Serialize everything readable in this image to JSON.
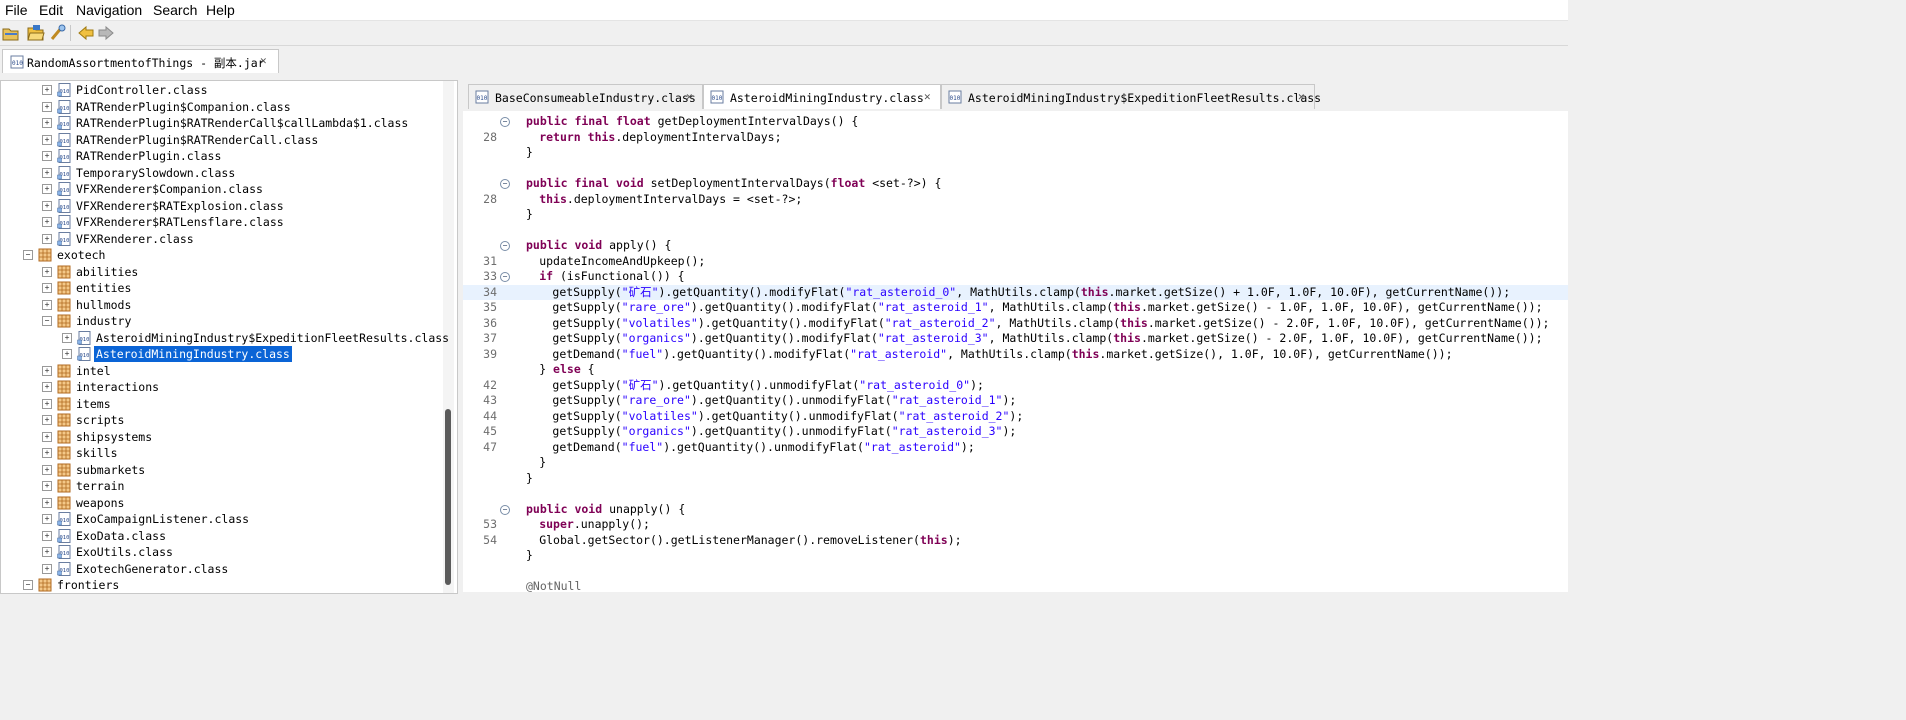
{
  "menu": [
    "File",
    "Edit",
    "Navigation",
    "Search",
    "Help"
  ],
  "toolbar": {
    "buttons": [
      "open-file-icon",
      "open-folder-icon",
      "search-type-icon",
      "back-icon",
      "forward-icon"
    ]
  },
  "left": {
    "file_tab": {
      "label": "RandomAssortmentofThings - 副本.jar"
    },
    "tree": [
      {
        "label": "PidController.class",
        "type": "class",
        "level": 2,
        "expander": "+"
      },
      {
        "label": "RATRenderPlugin$Companion.class",
        "type": "class",
        "level": 2,
        "expander": "+"
      },
      {
        "label": "RATRenderPlugin$RATRenderCall$callLambda$1.class",
        "type": "class",
        "level": 2,
        "expander": "+"
      },
      {
        "label": "RATRenderPlugin$RATRenderCall.class",
        "type": "class",
        "level": 2,
        "expander": "+"
      },
      {
        "label": "RATRenderPlugin.class",
        "type": "class",
        "level": 2,
        "expander": "+"
      },
      {
        "label": "TemporarySlowdown.class",
        "type": "class",
        "level": 2,
        "expander": "+"
      },
      {
        "label": "VFXRenderer$Companion.class",
        "type": "class",
        "level": 2,
        "expander": "+"
      },
      {
        "label": "VFXRenderer$RATExplosion.class",
        "type": "class",
        "level": 2,
        "expander": "+"
      },
      {
        "label": "VFXRenderer$RATLensflare.class",
        "type": "class",
        "level": 2,
        "expander": "+"
      },
      {
        "label": "VFXRenderer.class",
        "type": "class",
        "level": 2,
        "expander": "+"
      },
      {
        "label": "exotech",
        "type": "package",
        "level": 1,
        "expander": "-"
      },
      {
        "label": "abilities",
        "type": "package",
        "level": 2,
        "expander": "+"
      },
      {
        "label": "entities",
        "type": "package",
        "level": 2,
        "expander": "+"
      },
      {
        "label": "hullmods",
        "type": "package",
        "level": 2,
        "expander": "+"
      },
      {
        "label": "industry",
        "type": "package",
        "level": 2,
        "expander": "-"
      },
      {
        "label": "AsteroidMiningIndustry$ExpeditionFleetResults.class",
        "type": "class",
        "level": 3,
        "expander": "+"
      },
      {
        "label": "AsteroidMiningIndustry.class",
        "type": "class",
        "level": 3,
        "expander": "+",
        "selected": true
      },
      {
        "label": "intel",
        "type": "package",
        "level": 2,
        "expander": "+"
      },
      {
        "label": "interactions",
        "type": "package",
        "level": 2,
        "expander": "+"
      },
      {
        "label": "items",
        "type": "package",
        "level": 2,
        "expander": "+"
      },
      {
        "label": "scripts",
        "type": "package",
        "level": 2,
        "expander": "+"
      },
      {
        "label": "shipsystems",
        "type": "package",
        "level": 2,
        "expander": "+"
      },
      {
        "label": "skills",
        "type": "package",
        "level": 2,
        "expander": "+"
      },
      {
        "label": "submarkets",
        "type": "package",
        "level": 2,
        "expander": "+"
      },
      {
        "label": "terrain",
        "type": "package",
        "level": 2,
        "expander": "+"
      },
      {
        "label": "weapons",
        "type": "package",
        "level": 2,
        "expander": "+"
      },
      {
        "label": "ExoCampaignListener.class",
        "type": "class",
        "level": 2,
        "expander": "+"
      },
      {
        "label": "ExoData.class",
        "type": "class",
        "level": 2,
        "expander": "+"
      },
      {
        "label": "ExoUtils.class",
        "type": "class",
        "level": 2,
        "expander": "+"
      },
      {
        "label": "ExotechGenerator.class",
        "type": "class",
        "level": 2,
        "expander": "+"
      },
      {
        "label": "frontiers",
        "type": "package",
        "level": 1,
        "expander": "-"
      }
    ]
  },
  "editor": {
    "tabs": [
      {
        "label": "BaseConsumeableIndustry.class",
        "active": false
      },
      {
        "label": "AsteroidMiningIndustry.class",
        "active": true
      },
      {
        "label": "AsteroidMiningIndustry$ExpeditionFleetResults.class",
        "active": false
      }
    ],
    "lines": [
      {
        "num": "",
        "fold": true,
        "indent": 0,
        "tokens": [
          [
            "kw",
            "public final float "
          ],
          [
            "t",
            "getDeploymentIntervalDays() {"
          ]
        ]
      },
      {
        "num": "28",
        "indent": 1,
        "tokens": [
          [
            "kw",
            "return this"
          ],
          [
            "t",
            ".deploymentIntervalDays;"
          ]
        ]
      },
      {
        "num": "",
        "indent": 0,
        "tokens": [
          [
            "t",
            "}"
          ]
        ]
      },
      {
        "num": "",
        "indent": 0,
        "tokens": []
      },
      {
        "num": "",
        "fold": true,
        "indent": 0,
        "tokens": [
          [
            "kw",
            "public final void "
          ],
          [
            "t",
            "setDeploymentIntervalDays("
          ],
          [
            "kw",
            "float "
          ],
          [
            "t",
            "<set-?>) {"
          ]
        ]
      },
      {
        "num": "28",
        "indent": 1,
        "tokens": [
          [
            "kw",
            "this"
          ],
          [
            "t",
            ".deploymentIntervalDays = <set-?>;"
          ]
        ]
      },
      {
        "num": "",
        "indent": 0,
        "tokens": [
          [
            "t",
            "}"
          ]
        ]
      },
      {
        "num": "",
        "indent": 0,
        "tokens": []
      },
      {
        "num": "",
        "fold": true,
        "indent": 0,
        "tokens": [
          [
            "kw",
            "public void "
          ],
          [
            "t",
            "apply() {"
          ]
        ]
      },
      {
        "num": "31",
        "indent": 1,
        "tokens": [
          [
            "t",
            "updateIncomeAndUpkeep();"
          ]
        ]
      },
      {
        "num": "33",
        "fold": true,
        "indent": 1,
        "tokens": [
          [
            "kw",
            "if "
          ],
          [
            "t",
            "(isFunctional()) {"
          ]
        ]
      },
      {
        "num": "34",
        "hl": true,
        "indent": 2,
        "tokens": [
          [
            "t",
            "getSupply("
          ],
          [
            "str",
            "\"矿石\""
          ],
          [
            "t",
            ").getQuantity().modifyFlat("
          ],
          [
            "str",
            "\"rat_asteroid_0\""
          ],
          [
            "t",
            ", MathUtils.clamp("
          ],
          [
            "kw",
            "this"
          ],
          [
            "t",
            ".market.getSize() + 1.0F, 1.0F, 10.0F), getCurrentName());"
          ]
        ]
      },
      {
        "num": "35",
        "indent": 2,
        "tokens": [
          [
            "t",
            "getSupply("
          ],
          [
            "str",
            "\"rare_ore\""
          ],
          [
            "t",
            ").getQuantity().modifyFlat("
          ],
          [
            "str",
            "\"rat_asteroid_1\""
          ],
          [
            "t",
            ", MathUtils.clamp("
          ],
          [
            "kw",
            "this"
          ],
          [
            "t",
            ".market.getSize() - 1.0F, 1.0F, 10.0F), getCurrentName());"
          ]
        ]
      },
      {
        "num": "36",
        "indent": 2,
        "tokens": [
          [
            "t",
            "getSupply("
          ],
          [
            "str",
            "\"volatiles\""
          ],
          [
            "t",
            ").getQuantity().modifyFlat("
          ],
          [
            "str",
            "\"rat_asteroid_2\""
          ],
          [
            "t",
            ", MathUtils.clamp("
          ],
          [
            "kw",
            "this"
          ],
          [
            "t",
            ".market.getSize() - 2.0F, 1.0F, 10.0F), getCurrentName());"
          ]
        ]
      },
      {
        "num": "37",
        "indent": 2,
        "tokens": [
          [
            "t",
            "getSupply("
          ],
          [
            "str",
            "\"organics\""
          ],
          [
            "t",
            ").getQuantity().modifyFlat("
          ],
          [
            "str",
            "\"rat_asteroid_3\""
          ],
          [
            "t",
            ", MathUtils.clamp("
          ],
          [
            "kw",
            "this"
          ],
          [
            "t",
            ".market.getSize() - 2.0F, 1.0F, 10.0F), getCurrentName());"
          ]
        ]
      },
      {
        "num": "39",
        "indent": 2,
        "tokens": [
          [
            "t",
            "getDemand("
          ],
          [
            "str",
            "\"fuel\""
          ],
          [
            "t",
            ").getQuantity().modifyFlat("
          ],
          [
            "str",
            "\"rat_asteroid\""
          ],
          [
            "t",
            ", MathUtils.clamp("
          ],
          [
            "kw",
            "this"
          ],
          [
            "t",
            ".market.getSize(), 1.0F, 10.0F), getCurrentName());"
          ]
        ]
      },
      {
        "num": "",
        "indent": 1,
        "tokens": [
          [
            "t",
            "} "
          ],
          [
            "kw",
            "else "
          ],
          [
            "t",
            "{"
          ]
        ]
      },
      {
        "num": "42",
        "indent": 2,
        "tokens": [
          [
            "t",
            "getSupply("
          ],
          [
            "str",
            "\"矿石\""
          ],
          [
            "t",
            ").getQuantity().unmodifyFlat("
          ],
          [
            "str",
            "\"rat_asteroid_0\""
          ],
          [
            "t",
            ");"
          ]
        ]
      },
      {
        "num": "43",
        "indent": 2,
        "tokens": [
          [
            "t",
            "getSupply("
          ],
          [
            "str",
            "\"rare_ore\""
          ],
          [
            "t",
            ").getQuantity().unmodifyFlat("
          ],
          [
            "str",
            "\"rat_asteroid_1\""
          ],
          [
            "t",
            ");"
          ]
        ]
      },
      {
        "num": "44",
        "indent": 2,
        "tokens": [
          [
            "t",
            "getSupply("
          ],
          [
            "str",
            "\"volatiles\""
          ],
          [
            "t",
            ").getQuantity().unmodifyFlat("
          ],
          [
            "str",
            "\"rat_asteroid_2\""
          ],
          [
            "t",
            ");"
          ]
        ]
      },
      {
        "num": "45",
        "indent": 2,
        "tokens": [
          [
            "t",
            "getSupply("
          ],
          [
            "str",
            "\"organics\""
          ],
          [
            "t",
            ").getQuantity().unmodifyFlat("
          ],
          [
            "str",
            "\"rat_asteroid_3\""
          ],
          [
            "t",
            ");"
          ]
        ]
      },
      {
        "num": "47",
        "indent": 2,
        "tokens": [
          [
            "t",
            "getDemand("
          ],
          [
            "str",
            "\"fuel\""
          ],
          [
            "t",
            ").getQuantity().unmodifyFlat("
          ],
          [
            "str",
            "\"rat_asteroid\""
          ],
          [
            "t",
            ");"
          ]
        ]
      },
      {
        "num": "",
        "indent": 1,
        "tokens": [
          [
            "t",
            "}"
          ]
        ]
      },
      {
        "num": "",
        "indent": 0,
        "tokens": [
          [
            "t",
            "}"
          ]
        ]
      },
      {
        "num": "",
        "indent": 0,
        "tokens": []
      },
      {
        "num": "",
        "fold": true,
        "indent": 0,
        "tokens": [
          [
            "kw",
            "public void "
          ],
          [
            "t",
            "unapply() {"
          ]
        ]
      },
      {
        "num": "53",
        "indent": 1,
        "tokens": [
          [
            "kw",
            "super"
          ],
          [
            "t",
            ".unapply();"
          ]
        ]
      },
      {
        "num": "54",
        "indent": 1,
        "tokens": [
          [
            "t",
            "Global.getSector().getListenerManager().removeListener("
          ],
          [
            "kw",
            "this"
          ],
          [
            "t",
            ");"
          ]
        ]
      },
      {
        "num": "",
        "indent": 0,
        "tokens": [
          [
            "t",
            "}"
          ]
        ]
      },
      {
        "num": "",
        "indent": 0,
        "tokens": []
      },
      {
        "num": "",
        "indent": 0,
        "tokens": [
          [
            "ann",
            "@NotNull"
          ]
        ]
      }
    ]
  }
}
